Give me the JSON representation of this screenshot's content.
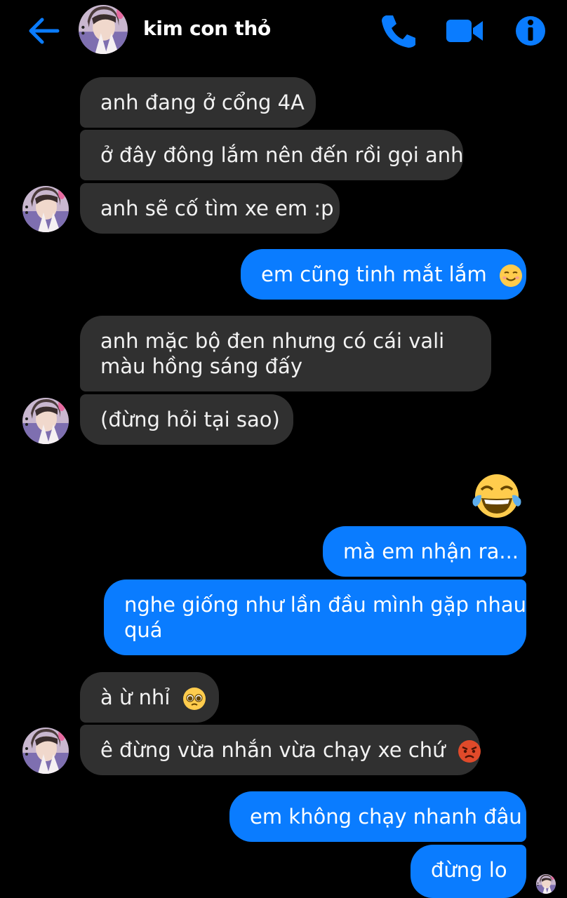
{
  "header": {
    "contact_name": "kim con thỏ",
    "icons": [
      "back-arrow-icon",
      "phone-icon",
      "video-camera-icon",
      "info-icon"
    ]
  },
  "colors": {
    "accent": "#0a7cff",
    "incoming_bubble": "#303030",
    "background": "#000000"
  },
  "messages": [
    {
      "from": "them",
      "text": "anh đang ở cổng 4A"
    },
    {
      "from": "them",
      "text": "ở đây đông lắm nên đến rồi gọi anh"
    },
    {
      "from": "them",
      "text": "anh sẽ cố tìm xe em :p"
    },
    {
      "from": "me",
      "text": "em cũng tinh mắt lắm",
      "emoji": "smiling-face-icon"
    },
    {
      "from": "them",
      "line1": "anh mặc bộ đen nhưng có cái vali",
      "line2": "màu hồng sáng đấy"
    },
    {
      "from": "them",
      "text": "(đừng hỏi tại sao)"
    },
    {
      "from": "me",
      "emoji": "tears-of-joy-icon"
    },
    {
      "from": "me",
      "text": "mà em nhận ra..."
    },
    {
      "from": "me",
      "line1": "nghe giống như lần đầu mình gặp nhau",
      "line2": "quá"
    },
    {
      "from": "them",
      "text": "à ừ nhỉ",
      "emoji": "pleading-face-icon"
    },
    {
      "from": "them",
      "text": "ê đừng vừa nhắn vừa chạy xe chứ",
      "emoji": "angry-face-icon"
    },
    {
      "from": "me",
      "text": "em không chạy nhanh đâu"
    },
    {
      "from": "me",
      "text": "đừng lo"
    }
  ]
}
